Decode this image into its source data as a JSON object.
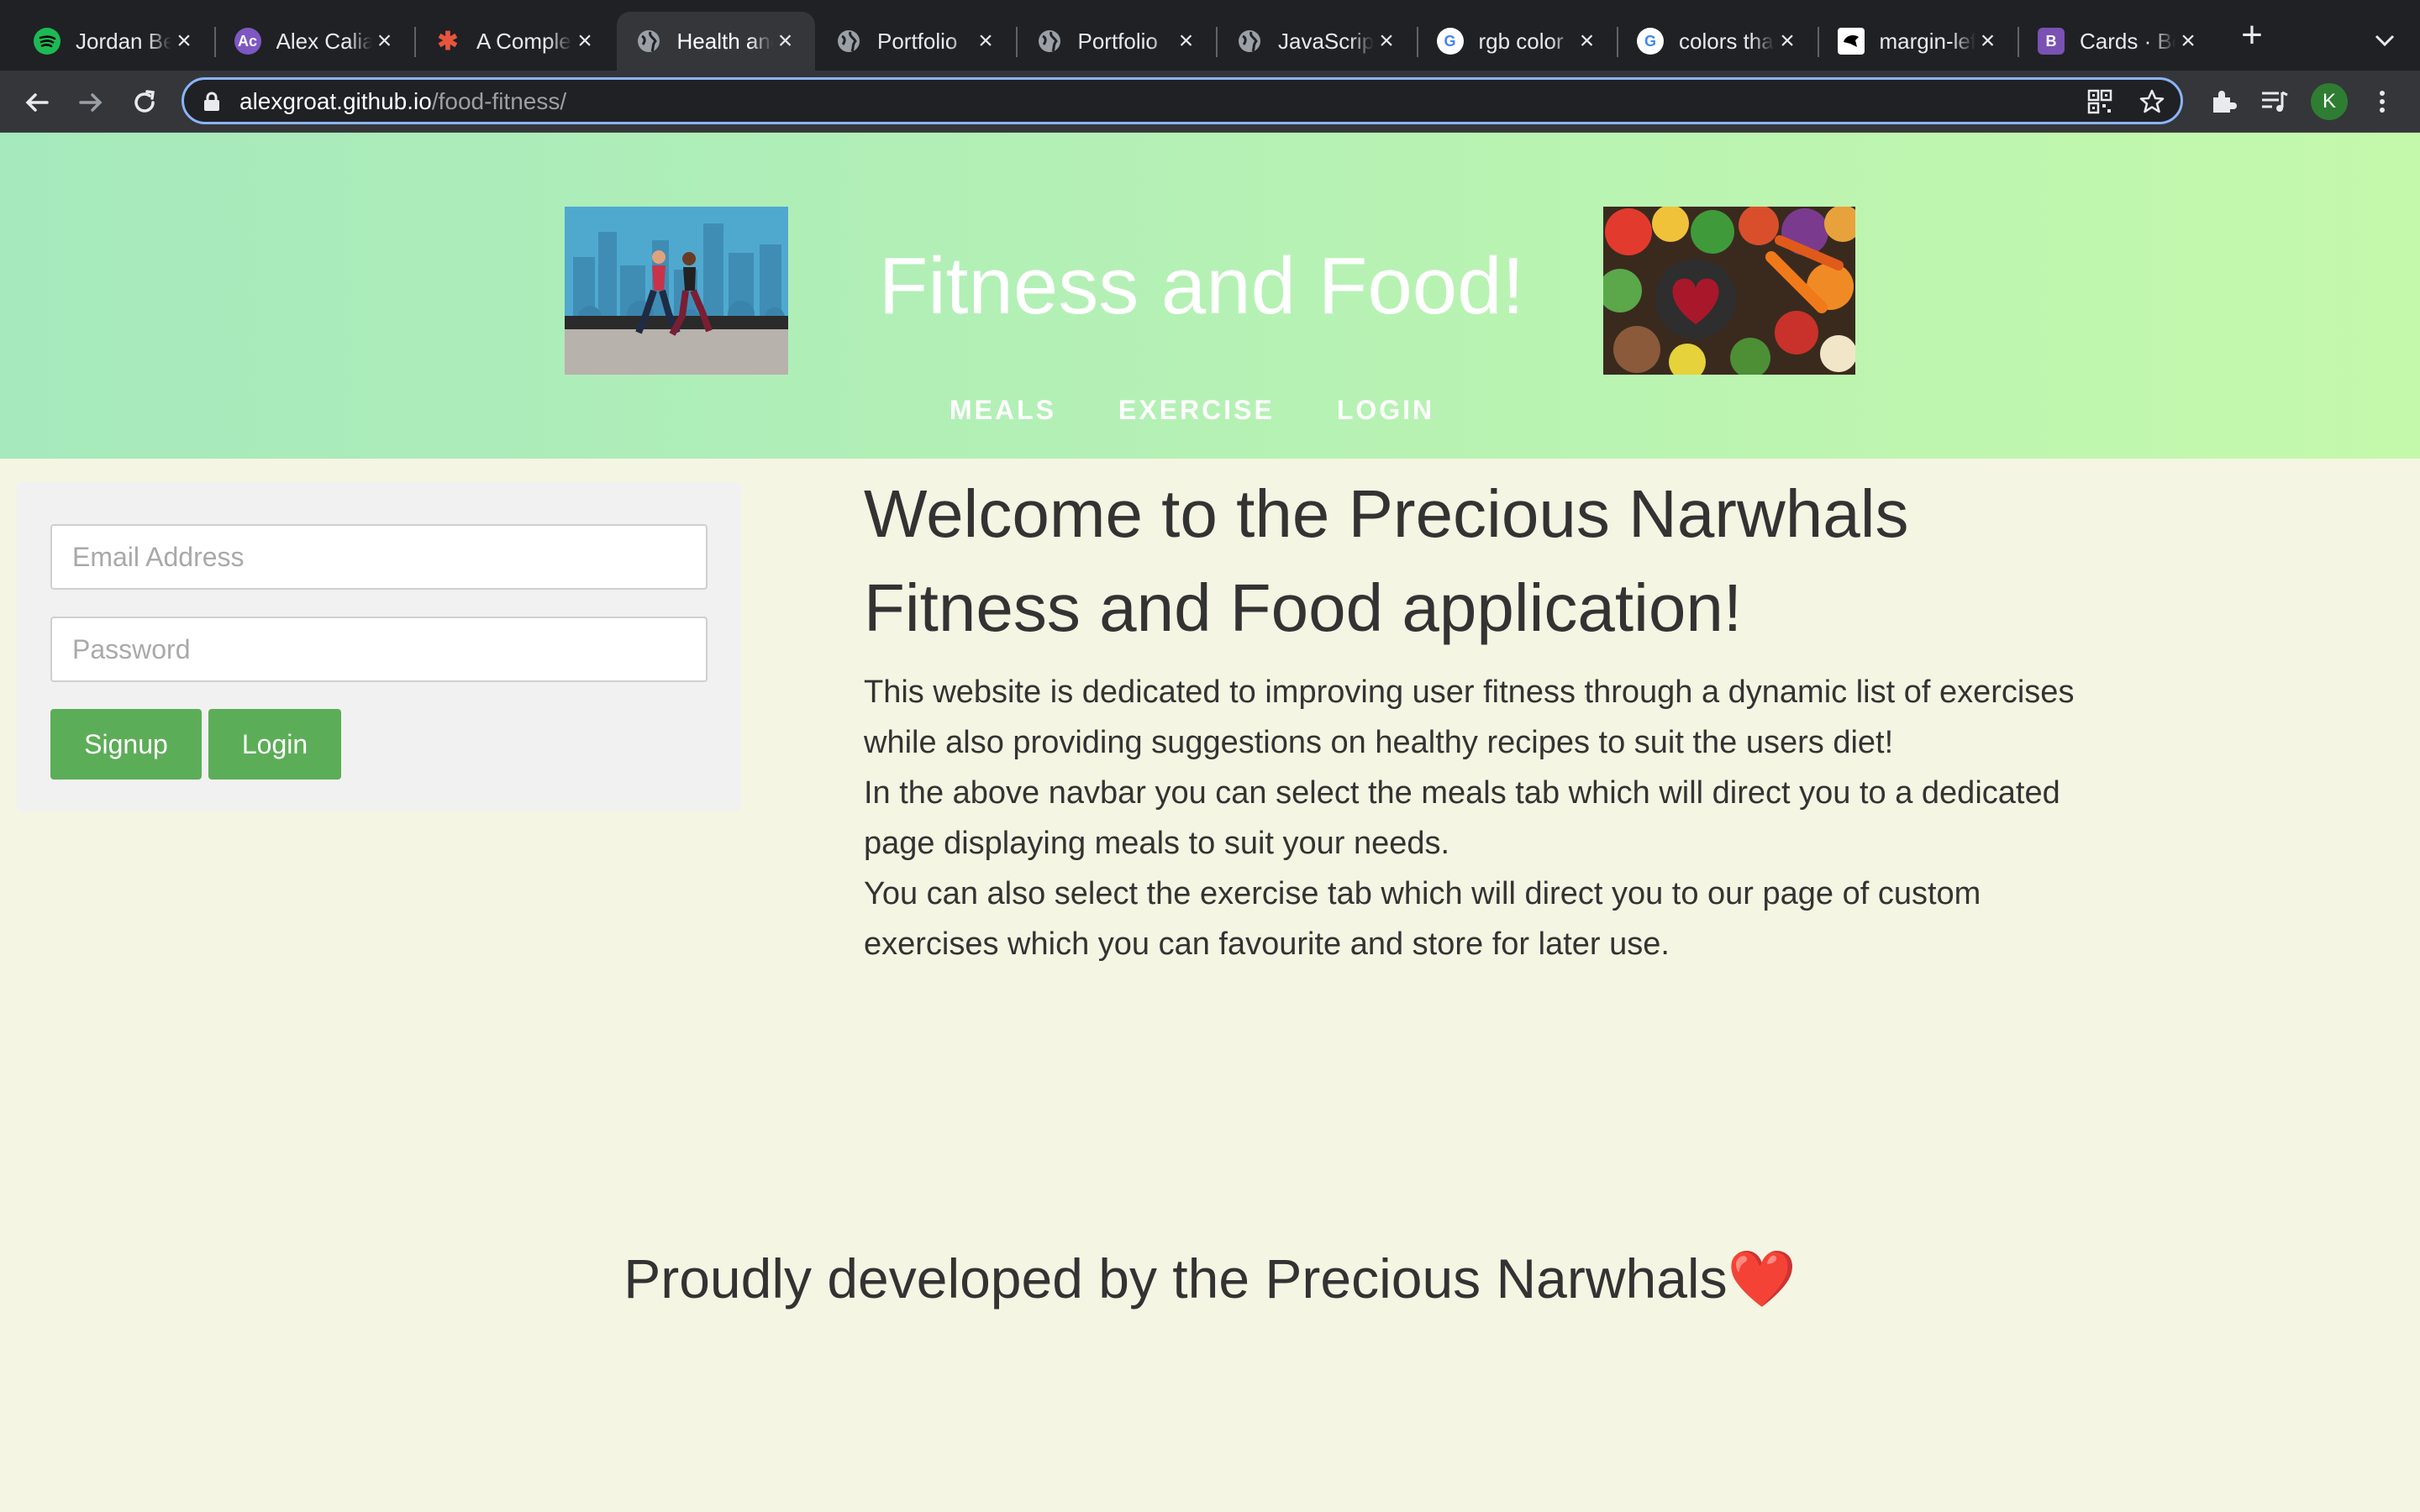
{
  "browser": {
    "tabs": [
      {
        "title": "Jordan Be",
        "icon": "spotify-icon",
        "color": "#1db954",
        "glyph": ""
      },
      {
        "title": "Alex Calia",
        "icon": "user-avatar-icon",
        "color": "#7e57c2",
        "glyph": "Ac"
      },
      {
        "title": "A Complete",
        "icon": "asterisk-icon",
        "color": "#e8553d",
        "glyph": "✱"
      },
      {
        "title": "Health and",
        "icon": "globe-icon",
        "color": "#9aa0a6",
        "glyph": ""
      },
      {
        "title": "Portfolio",
        "icon": "globe-icon",
        "color": "#9aa0a6",
        "glyph": ""
      },
      {
        "title": "Portfolio",
        "icon": "globe-icon",
        "color": "#9aa0a6",
        "glyph": ""
      },
      {
        "title": "JavaScript",
        "icon": "globe-icon",
        "color": "#9aa0a6",
        "glyph": ""
      },
      {
        "title": "rgb color",
        "icon": "google-icon",
        "color": "#ffffff",
        "glyph": "G"
      },
      {
        "title": "colors that",
        "icon": "google-icon",
        "color": "#ffffff",
        "glyph": "G"
      },
      {
        "title": "margin-left",
        "icon": "mdn-icon",
        "color": "#000000",
        "glyph": ""
      },
      {
        "title": "Cards · Bo",
        "icon": "bootstrap-icon",
        "color": "#7952b3",
        "glyph": "B"
      }
    ],
    "active_tab": 3,
    "url_host": "alexgroat.github.io",
    "url_path": "/food-fitness/",
    "profile_initial": "K"
  },
  "header": {
    "title": "Fitness and Food!",
    "nav": [
      "MEALS",
      "EXERCISE",
      "LOGIN"
    ]
  },
  "login": {
    "email_placeholder": "Email Address",
    "password_placeholder": "Password",
    "signup_label": "Signup",
    "login_label": "Login"
  },
  "welcome": {
    "title": "Welcome to the Precious Narwhals Fitness and Food application!",
    "paragraphs": [
      "This website is dedicated to improving user fitness through a dynamic list of exercises while also providing suggestions on healthy recipes to suit the users diet!",
      "In the above navbar you can select the meals tab which will direct you to a dedicated page displaying meals to suit your needs.",
      "You can also select the exercise tab which will direct you to our page of custom exercises which you can favourite and store for later use."
    ]
  },
  "footer": {
    "text": "Proudly developed by the Precious Narwhals",
    "emoji": "❤️"
  },
  "colors": {
    "hero_start": "#a6e9bd",
    "hero_end": "#c4f9ac",
    "page_bg": "#f4f5e2",
    "button": "#5cad58"
  }
}
